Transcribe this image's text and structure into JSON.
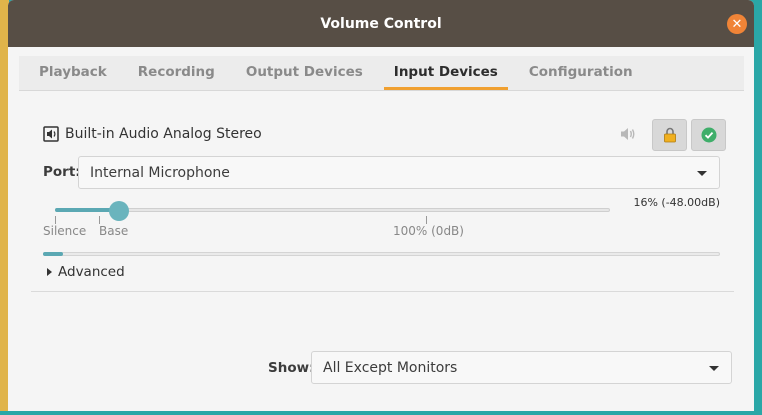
{
  "window": {
    "title": "Volume Control"
  },
  "tabs": [
    {
      "label": "Playback",
      "active": false
    },
    {
      "label": "Recording",
      "active": false
    },
    {
      "label": "Output Devices",
      "active": false
    },
    {
      "label": "Input Devices",
      "active": true
    },
    {
      "label": "Configuration",
      "active": false
    }
  ],
  "device": {
    "name": "Built-in Audio Analog Stereo",
    "port_label": "Port:",
    "port_value": "Internal Microphone",
    "volume_fraction": 0.16,
    "volume_text": "16% (-48.00dB)",
    "tick_silence": "Silence",
    "tick_base": "Base",
    "tick_100": "100% (0dB)",
    "peak_fraction": 0.03,
    "advanced_label": "Advanced"
  },
  "footer": {
    "show_label": "Show:",
    "show_value": "All Except Monitors"
  },
  "icons": {
    "close": "close-icon",
    "speaker": "speaker-icon",
    "mute": "volume-mute-icon",
    "lock": "lock-icon",
    "default": "check-circle-icon",
    "dropdown": "chevron-down-icon"
  },
  "colors": {
    "accent_tab": "#f0a030",
    "slider": "#5ba8b3",
    "close": "#f08437",
    "titlebar": "#574e45"
  }
}
